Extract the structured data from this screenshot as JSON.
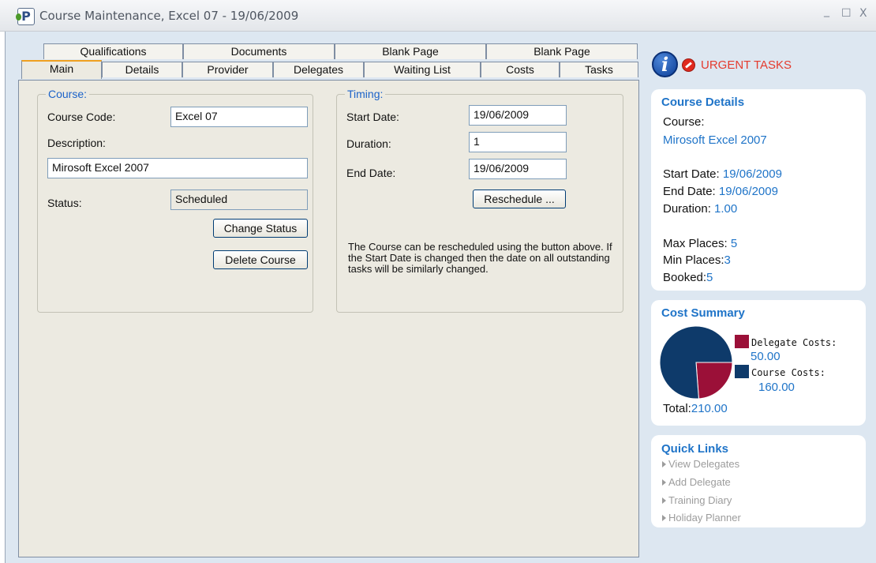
{
  "window": {
    "title": "Course Maintenance, Excel 07 - 19/06/2009",
    "app_icon": "P",
    "controls": {
      "minimize": "_",
      "maximize": "☐",
      "close": "X"
    }
  },
  "tabs": {
    "row1": [
      "Qualifications",
      "Documents",
      "Blank Page",
      "Blank Page"
    ],
    "row2": [
      "Main",
      "Details",
      "Provider",
      "Delegates",
      "Waiting List",
      "Costs",
      "Tasks"
    ],
    "active": "Main"
  },
  "course": {
    "legend": "Course:",
    "code_label": "Course Code:",
    "code_value": "Excel 07",
    "description_label": "Description:",
    "description_value": "Mirosoft Excel 2007",
    "status_label": "Status:",
    "status_value": "Scheduled",
    "change_status_label": "Change Status",
    "delete_course_label": "Delete Course"
  },
  "timing": {
    "legend": "Timing:",
    "start_label": "Start Date:",
    "start_value": "19/06/2009",
    "duration_label": "Duration:",
    "duration_value": "1",
    "end_label": "End Date:",
    "end_value": "19/06/2009",
    "reschedule_label": "Reschedule ...",
    "note": "The Course can be rescheduled using the button above. If the Start Date is changed then the date on all outstanding tasks will be similarly changed."
  },
  "urgent_tasks": {
    "label": "URGENT TASKS",
    "icons": [
      "info-icon",
      "alert-icon"
    ]
  },
  "course_details": {
    "title": "Course Details",
    "course_label": "Course:",
    "course_value": "Mirosoft Excel 2007",
    "start_label": "Start Date:",
    "start_value": "19/06/2009",
    "end_label": "End Date:",
    "end_value": "19/06/2009",
    "duration_label": "Duration:",
    "duration_value": "1.00",
    "max_label": "Max Places:",
    "max_value": "5",
    "min_label": "Min Places:",
    "min_value": "3",
    "booked_label": "Booked:",
    "booked_value": "5"
  },
  "cost_summary": {
    "title": "Cost Summary",
    "delegate_label": "Delegate Costs:",
    "delegate_value": "50.00",
    "course_label": "Course Costs:",
    "course_value": "160.00",
    "total_label": "Total:",
    "total_value": "210.00",
    "colors": {
      "delegate": "#9b1038",
      "course": "#0e3a6a"
    }
  },
  "chart_data": {
    "type": "pie",
    "categories": [
      "Delegate Costs",
      "Course Costs"
    ],
    "values": [
      50.0,
      160.0
    ],
    "title": ""
  },
  "quick_links": {
    "title": "Quick Links",
    "items": [
      "View Delegates",
      "Add Delegate",
      "Training Diary",
      "Holiday Planner"
    ]
  }
}
